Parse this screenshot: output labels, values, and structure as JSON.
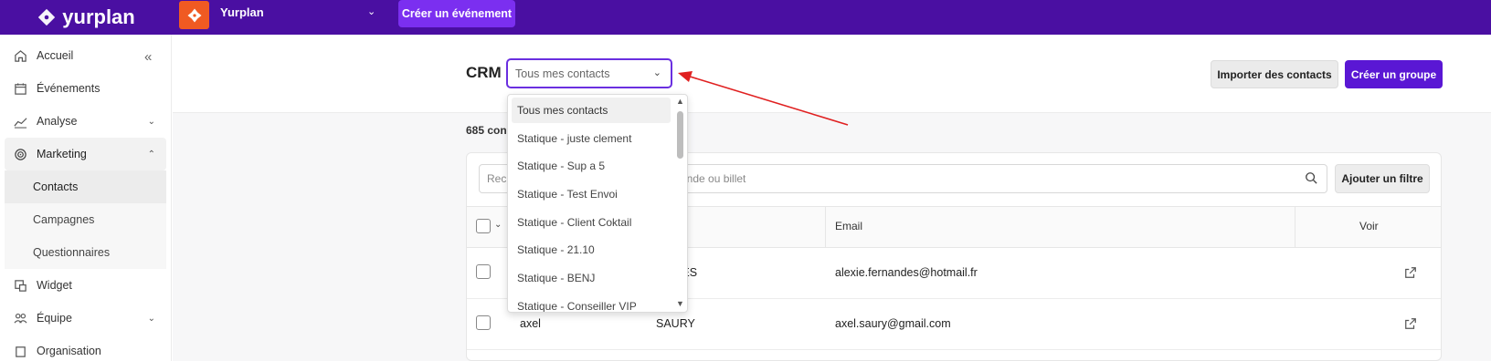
{
  "topbar": {
    "brand_name": "yurplan",
    "org_name": "Yurplan",
    "create_event_label": "Créer un événement"
  },
  "sidebar": {
    "items": [
      {
        "label": "Accueil",
        "icon": "home-icon"
      },
      {
        "label": "Événements",
        "icon": "calendar-icon"
      },
      {
        "label": "Analyse",
        "icon": "chart-line-icon"
      },
      {
        "label": "Marketing",
        "icon": "target-icon"
      },
      {
        "label": "Widget",
        "icon": "widget-icon"
      },
      {
        "label": "Équipe",
        "icon": "team-icon"
      },
      {
        "label": "Organisation",
        "icon": "organisation-icon"
      }
    ],
    "marketing_subitems": [
      {
        "label": "Contacts"
      },
      {
        "label": "Campagnes"
      },
      {
        "label": "Questionnaires"
      }
    ]
  },
  "header": {
    "title": "CRM",
    "select_value": "Tous mes contacts",
    "import_label": "Importer des contacts",
    "create_group_label": "Créer un groupe"
  },
  "main": {
    "count_text": "685 con",
    "search_placeholder_left": "Rech",
    "search_placeholder_right": "mande ou billet",
    "filter_label": "Ajouter un filtre"
  },
  "table": {
    "headers": {
      "email": "Email",
      "voir": "Voir"
    },
    "rows": [
      {
        "firstname": "",
        "lastname": "ANDES",
        "email": "alexie.fernandes@hotmail.fr"
      },
      {
        "firstname": "axel",
        "lastname": "SAURY",
        "email": "axel.saury@gmail.com"
      }
    ]
  },
  "dropdown": {
    "options": [
      "Tous mes contacts",
      "Statique - juste clement",
      "Statique - Sup a 5",
      "Statique - Test Envoi",
      "Statique - Client Coktail",
      "Statique - 21.10",
      "Statique - BENJ",
      "Statique - Conseiller VIP"
    ]
  },
  "colors": {
    "topbar": "#4a0fa2",
    "accent": "#5a17d4",
    "annotation_arrow": "#e02020"
  }
}
